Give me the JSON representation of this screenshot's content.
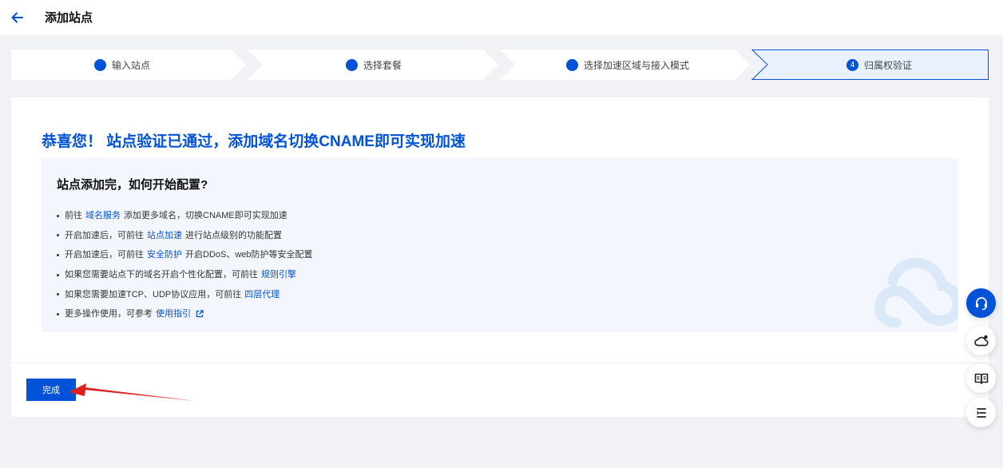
{
  "header": {
    "title": "添加站点",
    "back_icon": "arrow-left-icon"
  },
  "steps": [
    {
      "label": "输入站点",
      "state": "done"
    },
    {
      "label": "选择套餐",
      "state": "done"
    },
    {
      "label": "选择加速区域与接入模式",
      "state": "done"
    },
    {
      "label": "归属权验证",
      "state": "current",
      "number": "4"
    }
  ],
  "main": {
    "headline": "恭喜您！ 站点验证已通过，添加域名切换CNAME即可实现加速",
    "info_title": "站点添加完，如何开始配置?",
    "items": [
      {
        "pre": "前往",
        "link": "域名服务",
        "post": "添加更多域名，切换CNAME即可实现加速"
      },
      {
        "pre": "开启加速后，可前往",
        "link": "站点加速",
        "post": "进行站点级别的功能配置"
      },
      {
        "pre": "开启加速后，可前往",
        "link": "安全防护",
        "post": "开启DDoS、web防护等安全配置"
      },
      {
        "pre": "如果您需要站点下的域名开启个性化配置，可前往",
        "link": "规则引擎",
        "post": ""
      },
      {
        "pre": "如果您需要加速TCP、UDP协议应用，可前往",
        "link": "四层代理",
        "post": ""
      },
      {
        "pre": "更多操作使用，可参考",
        "link": "使用指引",
        "post": ""
      }
    ],
    "done_label": "完成"
  },
  "float_buttons": [
    "headset-icon",
    "cloud-settings-icon",
    "book-icon",
    "list-icon"
  ],
  "colors": {
    "accent": "#0052d9",
    "annotation_arrow": "#e02020",
    "info_bg": "#f3f7fd",
    "current_step_bg": "#e8f1fd"
  }
}
